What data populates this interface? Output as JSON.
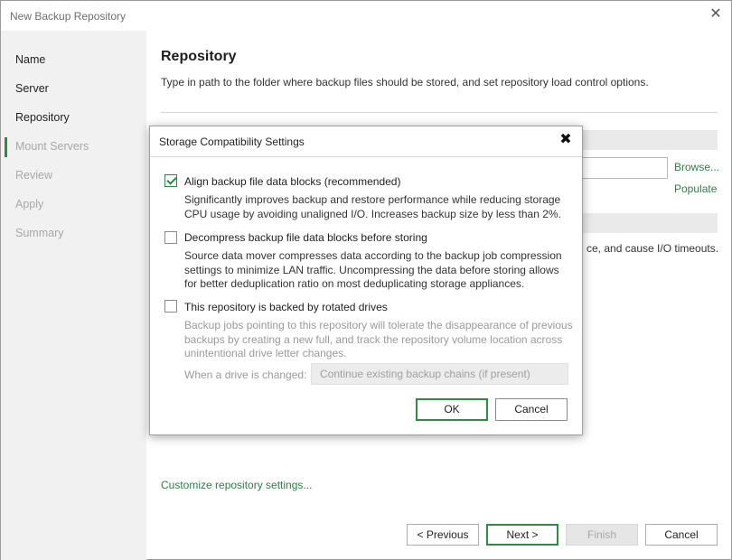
{
  "window": {
    "title": "New Backup Repository",
    "close_glyph": "✕"
  },
  "sidebar": {
    "items": [
      {
        "label": "Name",
        "state": "done"
      },
      {
        "label": "Server",
        "state": "done"
      },
      {
        "label": "Repository",
        "state": "current"
      },
      {
        "label": "Mount Servers",
        "state": "pending"
      },
      {
        "label": "Review",
        "state": "pending"
      },
      {
        "label": "Apply",
        "state": "pending"
      },
      {
        "label": "Summary",
        "state": "pending"
      }
    ]
  },
  "main": {
    "heading": "Repository",
    "description": "Type in path to the folder where backup files should be stored, and set repository load control options.",
    "browse_link": "Browse...",
    "populate_link": "Populate",
    "partial_text": "ce, and cause I/O timeouts.",
    "customize_link": "Customize repository settings..."
  },
  "footer": {
    "previous_label": "< Previous",
    "next_label": "Next >",
    "finish_label": "Finish",
    "cancel_label": "Cancel"
  },
  "dialog": {
    "title": "Storage Compatibility Settings",
    "close_glyph": "✖",
    "options": [
      {
        "label": "Align backup file data blocks (recommended)",
        "checked": true,
        "enabled": true,
        "description": "Significantly improves backup and restore performance while reducing storage CPU usage by avoiding unaligned I/O. Increases backup size by less than 2%."
      },
      {
        "label": "Decompress backup file data blocks before storing",
        "checked": false,
        "enabled": true,
        "description": "Source data mover compresses data according to the backup job compression settings to minimize LAN traffic. Uncompressing the data before storing allows for better deduplication ratio on most deduplicating storage appliances."
      },
      {
        "label": "This repository is backed by rotated drives",
        "checked": false,
        "enabled": true,
        "description": "Backup jobs pointing to this repository will tolerate the disappearance of previous backups by creating a new full, and track the repository volume location across unintentional drive letter changes."
      }
    ],
    "drive_change_label": "When a drive is changed:",
    "drive_change_value": "Continue existing backup chains (if present)",
    "ok_label": "OK",
    "cancel_label": "Cancel"
  },
  "colors": {
    "accent_green": "#2f8a46",
    "link_green": "#2f7d46",
    "sidebar_bg": "#f1f1f1"
  }
}
